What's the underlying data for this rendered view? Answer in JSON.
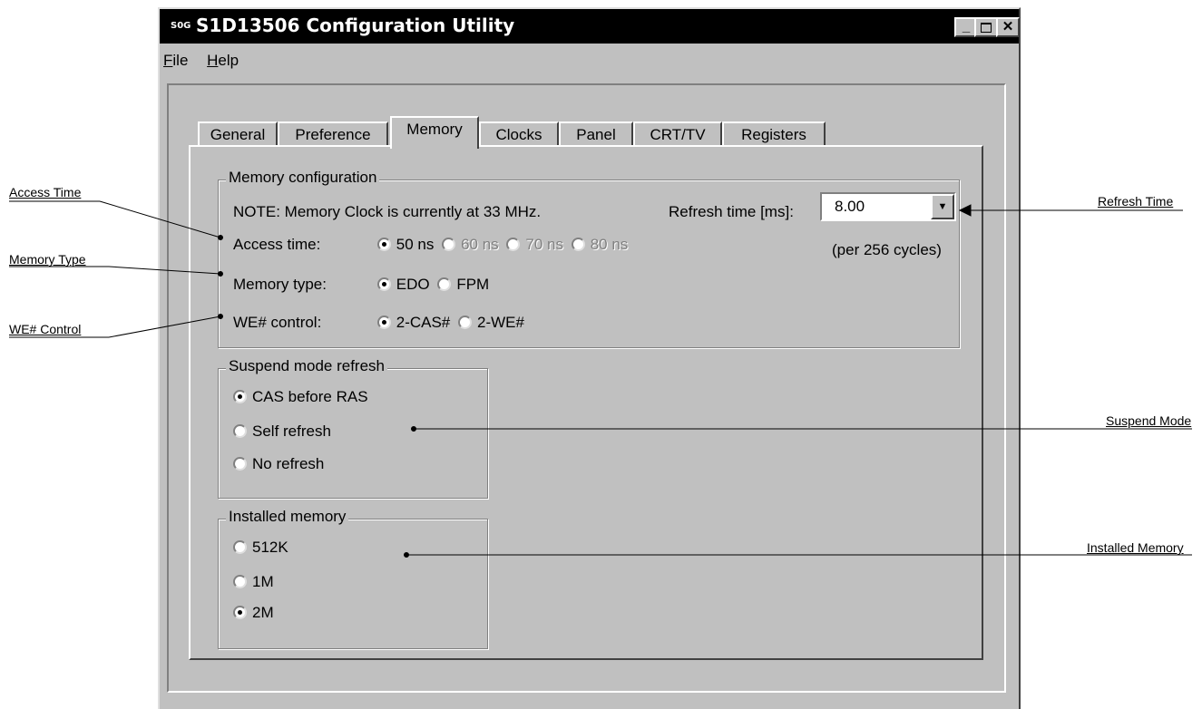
{
  "window": {
    "title": "S1D13506 Configuration Utility",
    "icon_label": "S0G"
  },
  "menu": [
    "File",
    "Help"
  ],
  "tabs": [
    "General",
    "Preference",
    "Memory",
    "Clocks",
    "Panel",
    "CRT/TV",
    "Registers"
  ],
  "active_tab": "Memory",
  "memory_config": {
    "group_label": "Memory configuration",
    "note": "NOTE: Memory Clock is currently at 33 MHz.",
    "refresh_label": "Refresh time [ms]:",
    "refresh_value": "8.00",
    "refresh_note": "(per 256 cycles)",
    "access_label": "Access time:",
    "access_options": [
      "50 ns",
      "60 ns",
      "70 ns",
      "80 ns"
    ],
    "access_selected": "50 ns",
    "type_label": "Memory type:",
    "type_options": [
      "EDO",
      "FPM"
    ],
    "type_selected": "EDO",
    "we_label": "WE# control:",
    "we_options": [
      "2-CAS#",
      "2-WE#"
    ],
    "we_selected": "2-CAS#"
  },
  "suspend": {
    "group_label": "Suspend mode refresh",
    "options": [
      "CAS before RAS",
      "Self refresh",
      "No refresh"
    ],
    "selected": "CAS before RAS"
  },
  "installed": {
    "group_label": "Installed memory",
    "options": [
      "512K",
      "1M",
      "2M"
    ],
    "selected": "2M"
  },
  "callouts": {
    "access_time": "Access Time",
    "memory_type": "Memory Type",
    "we_control": "WE# Control",
    "refresh_time": "Refresh Time",
    "suspend_mode": "Suspend Mode",
    "installed_memory": "Installed Memory"
  }
}
